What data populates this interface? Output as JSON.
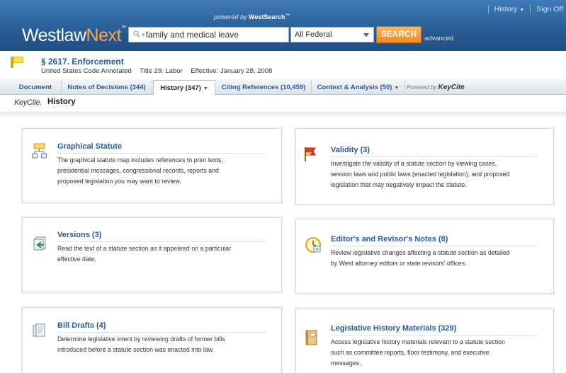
{
  "header": {
    "top_links": {
      "history": "History",
      "sign_off": "Sign Off"
    },
    "powered_prefix": "powered by",
    "powered_brand": "WestSearch",
    "powered_tm": "™",
    "logo_westlaw": "Westlaw",
    "logo_next": "Next",
    "logo_tm": "™",
    "search_value": "family and medical leave",
    "jurisdiction": "All Federal",
    "search_button": "SEARCH",
    "advanced": "advanced"
  },
  "document": {
    "title": "§ 2617. Enforcement",
    "source": "United States Code Annotated",
    "title_ref": "Title 29. Labor",
    "effective": "Effective: January 28, 2008"
  },
  "tabs": [
    {
      "label": "Document"
    },
    {
      "label": "Notes of Decisions (344)"
    },
    {
      "label": "History (347)"
    },
    {
      "label": "Citing References (10,459)"
    },
    {
      "label": "Context & Analysis (50)"
    }
  ],
  "tabs_powered_prefix": "Powered by",
  "tabs_powered_brand": "KeyCite",
  "keycite": {
    "logo": "KeyCite.",
    "section": "History"
  },
  "cards": [
    {
      "title": "Graphical Statute",
      "desc_lines": [
        "The graphical statute map includes references to prior texts,",
        "presidential messages, congressional records, reports and",
        "proposed legislation you may want to review."
      ],
      "icon": "flowchart-icon"
    },
    {
      "title": "Validity (3)",
      "desc_lines": [
        "Investigate the validity of a statute section by viewing cases,",
        "session laws and public laws (enacted legislation), and proposed",
        "legislation that may negatively impact the statute."
      ],
      "icon": "flag-icon"
    },
    {
      "title": "Versions (3)",
      "desc_lines": [
        "Read the text of a statute section as it appeared on a particular",
        "effective date."
      ],
      "icon": "versions-icon"
    },
    {
      "title": "Editor's and Revisor's Notes (8)",
      "desc_lines": [
        "Review legislative changes affecting a statute section as detailed",
        "by West attorney editors or state revisors' offices."
      ],
      "icon": "clock-note-icon"
    },
    {
      "title": "Bill Drafts (4)",
      "desc_lines": [
        "Determine legislative intent by reviewing drafts of former bills",
        "introduced before a statute section was enacted into law."
      ],
      "icon": "drafts-icon"
    },
    {
      "title": "Legislative History Materials (329)",
      "desc_lines": [
        "Access legislative history materials relevant to a statute section",
        "such as committee reports, floor testimony, and executive",
        "messages."
      ],
      "icon": "book-icon"
    }
  ],
  "colors": {
    "header_blue": "#2a5f98",
    "accent_orange": "#f08a1f",
    "link_blue": "#245aa0"
  }
}
